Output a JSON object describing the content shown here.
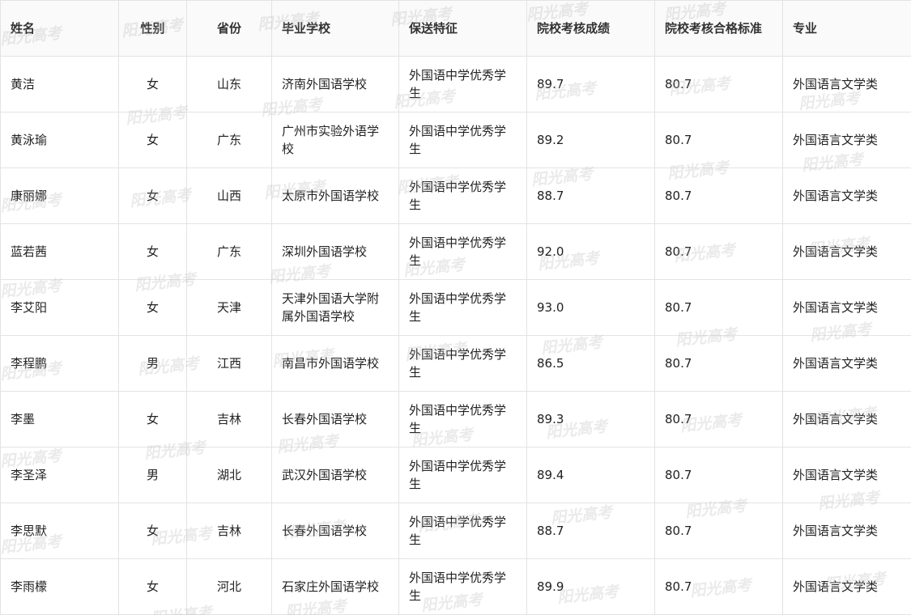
{
  "table": {
    "headers": [
      "姓名",
      "性别",
      "省份",
      "毕业学校",
      "保送特征",
      "院校考核成绩",
      "院校考核合格标准",
      "专业"
    ],
    "rows": [
      [
        "黄洁",
        "女",
        "山东",
        "济南外国语学校",
        "外国语中学优秀学生",
        "89.7",
        "80.7",
        "外国语言文学类"
      ],
      [
        "黄泳瑜",
        "女",
        "广东",
        "广州市实验外语学校",
        "外国语中学优秀学生",
        "89.2",
        "80.7",
        "外国语言文学类"
      ],
      [
        "康丽娜",
        "女",
        "山西",
        "太原市外国语学校",
        "外国语中学优秀学生",
        "88.7",
        "80.7",
        "外国语言文学类"
      ],
      [
        "蓝若茜",
        "女",
        "广东",
        "深圳外国语学校",
        "外国语中学优秀学生",
        "92.0",
        "80.7",
        "外国语言文学类"
      ],
      [
        "李艾阳",
        "女",
        "天津",
        "天津外国语大学附属外国语学校",
        "外国语中学优秀学生",
        "93.0",
        "80.7",
        "外国语言文学类"
      ],
      [
        "李程鹏",
        "男",
        "江西",
        "南昌市外国语学校",
        "外国语中学优秀学生",
        "86.5",
        "80.7",
        "外国语言文学类"
      ],
      [
        "李墨",
        "女",
        "吉林",
        "长春外国语学校",
        "外国语中学优秀学生",
        "89.3",
        "80.7",
        "外国语言文学类"
      ],
      [
        "李圣泽",
        "男",
        "湖北",
        "武汉外国语学校",
        "外国语中学优秀学生",
        "89.4",
        "80.7",
        "外国语言文学类"
      ],
      [
        "李思默",
        "女",
        "吉林",
        "长春外国语学校",
        "外国语中学优秀学生",
        "88.7",
        "80.7",
        "外国语言文学类"
      ],
      [
        "李雨檬",
        "女",
        "河北",
        "石家庄外国语学校",
        "外国语中学优秀学生",
        "89.9",
        "80.7",
        "外国语言文学类"
      ]
    ]
  },
  "watermark": {
    "text": "阳光高考"
  }
}
